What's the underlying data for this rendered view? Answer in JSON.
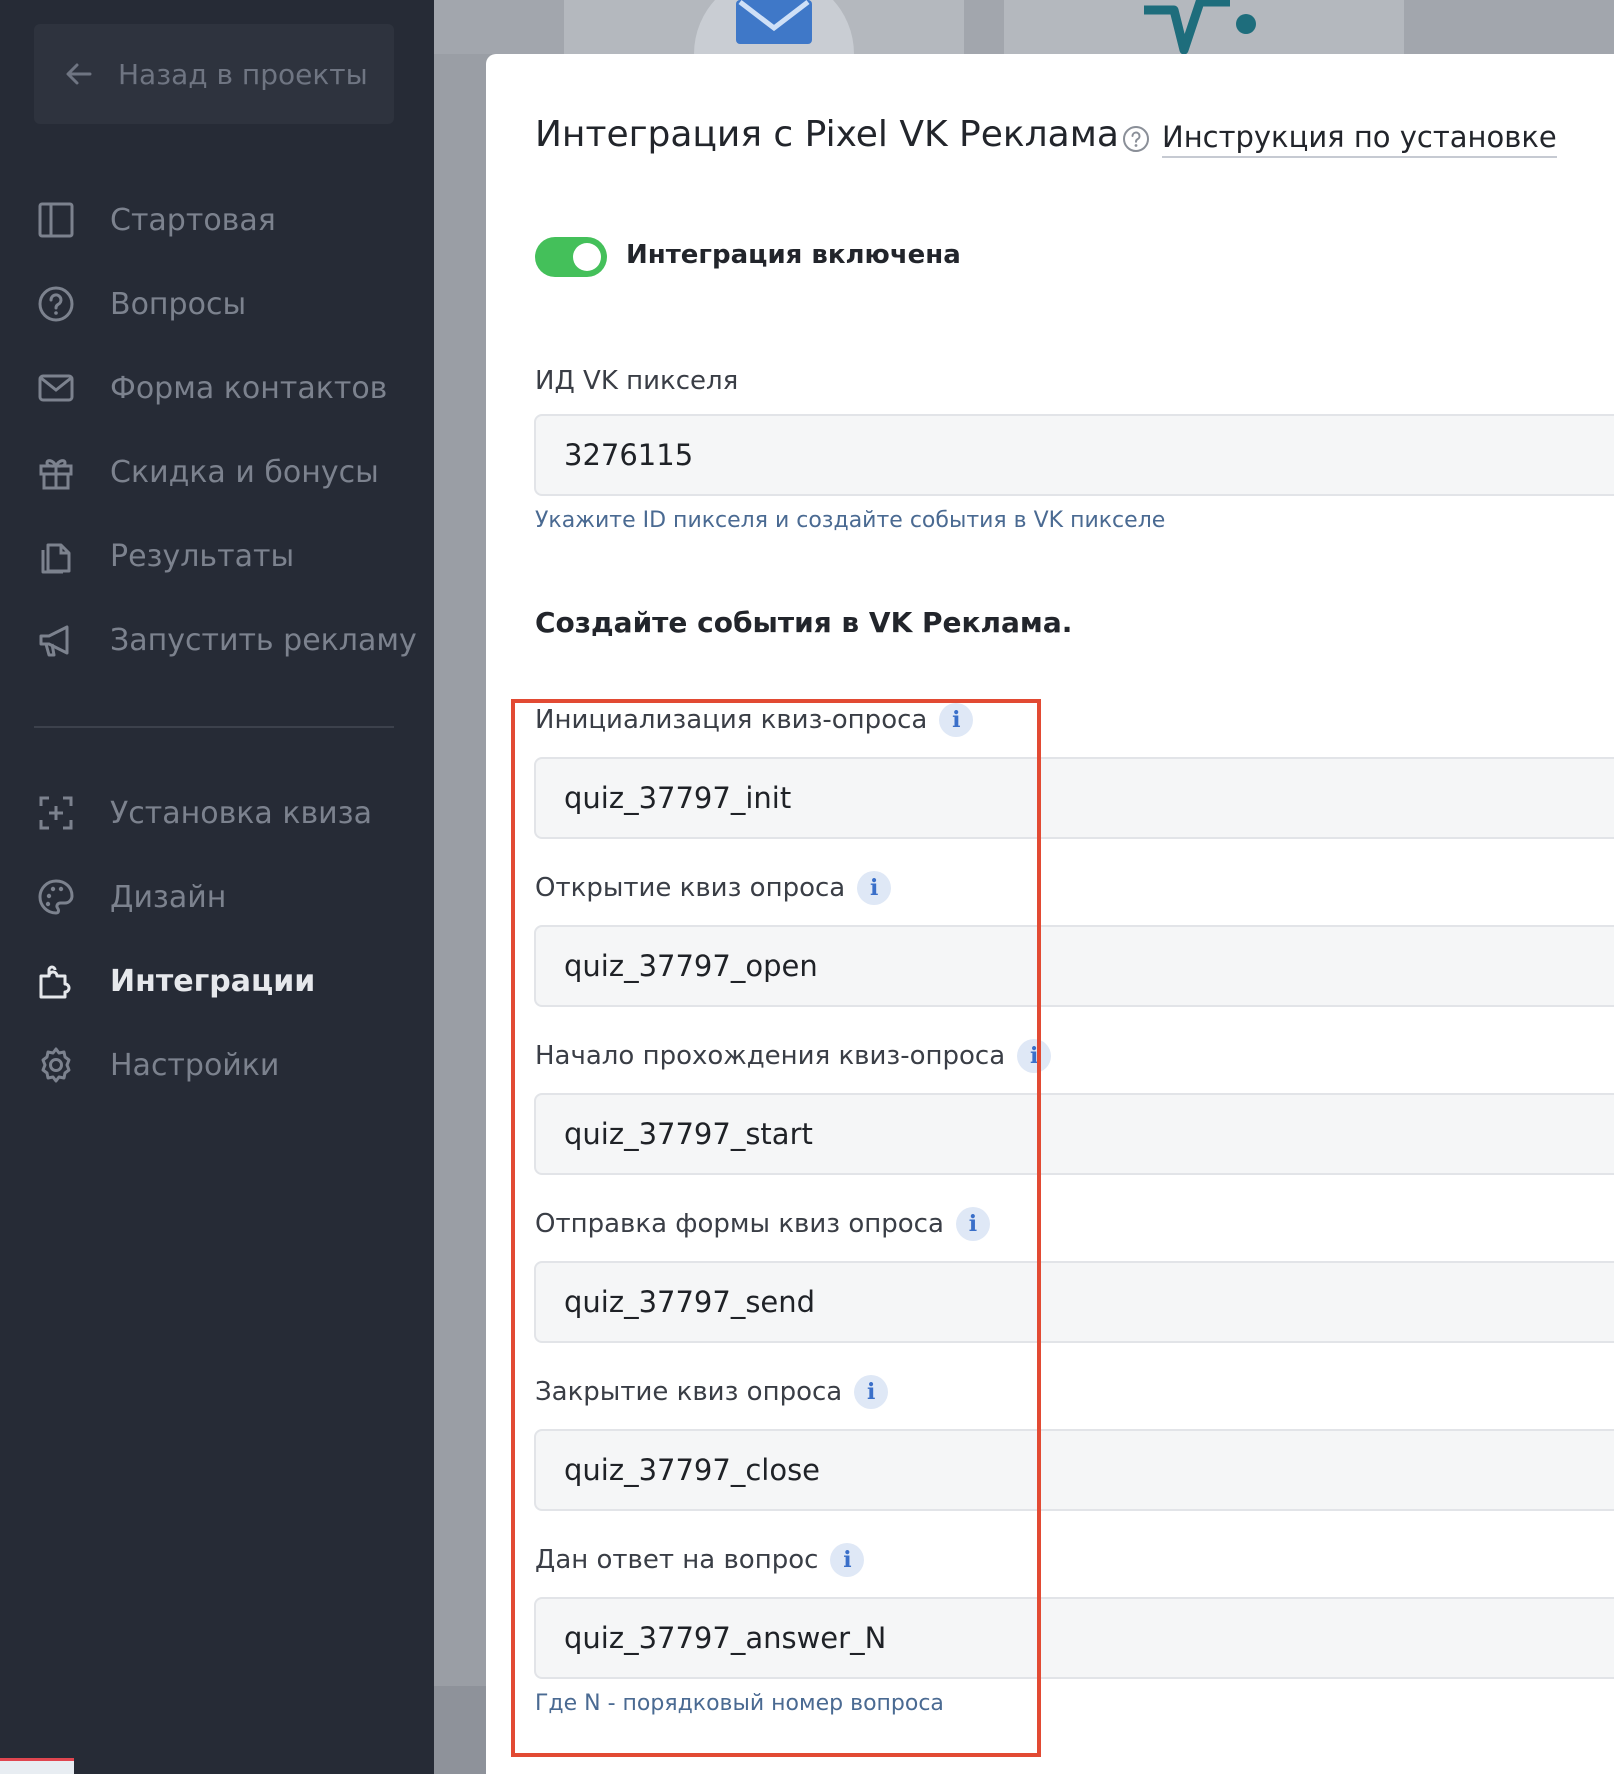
{
  "sidebar": {
    "back_label": "Назад в проекты",
    "items": [
      {
        "label": "Стартовая",
        "icon": "layout-icon"
      },
      {
        "label": "Вопросы",
        "icon": "question-circle-icon"
      },
      {
        "label": "Форма контактов",
        "icon": "envelope-icon"
      },
      {
        "label": "Скидка и бонусы",
        "icon": "gift-icon"
      },
      {
        "label": "Результаты",
        "icon": "documents-icon"
      },
      {
        "label": "Запустить рекламу",
        "icon": "megaphone-icon"
      },
      {
        "label": "Установка квиза",
        "icon": "install-frame-icon"
      },
      {
        "label": "Дизайн",
        "icon": "palette-icon"
      },
      {
        "label": "Интеграции",
        "icon": "puzzle-icon",
        "active": true
      },
      {
        "label": "Настройки",
        "icon": "gear-icon"
      }
    ]
  },
  "panel": {
    "title": "Интеграция с Pixel VK Реклама",
    "help_link": "Инструкция по установке",
    "toggle_label": "Интеграция включена",
    "toggle_on": true,
    "pixel_label": "ИД VK пикселя",
    "pixel_value": "3276115",
    "pixel_hint": "Укажите ID пикселя и создайте события в VK пикселе",
    "events_title": "Создайте события в VK Реклама.",
    "events": [
      {
        "label": "Инициализация квиз-опроса",
        "value": "quiz_37797_init"
      },
      {
        "label": "Открытие квиз опроса",
        "value": "quiz_37797_open"
      },
      {
        "label": "Начало прохождения квиз-опроса",
        "value": "quiz_37797_start"
      },
      {
        "label": "Отправка формы квиз опроса",
        "value": "quiz_37797_send"
      },
      {
        "label": "Закрытие квиз опроса",
        "value": "quiz_37797_close"
      },
      {
        "label": "Дан ответ на вопрос",
        "value": "quiz_37797_answer_N"
      }
    ],
    "answer_hint": "Где N - порядковый номер вопроса",
    "info_glyph": "i"
  },
  "colors": {
    "sidebar_bg": "#262b36",
    "toggle_on": "#44c05a",
    "highlight": "#e24a33",
    "hint_text": "#4a6a92"
  }
}
